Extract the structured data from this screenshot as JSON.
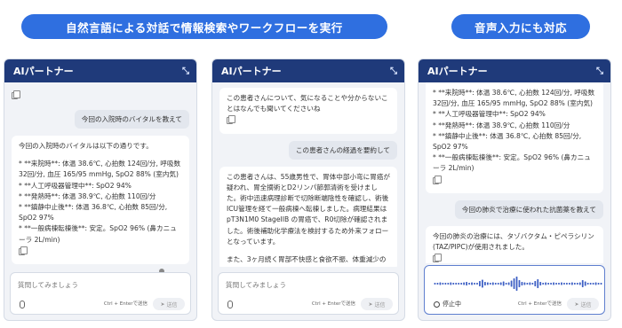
{
  "banners": {
    "left": "自然言語による対話で情報検索やワークフローを実行",
    "right": "音声入力にも対応"
  },
  "panel_title": "AIパートナー",
  "input": {
    "placeholder": "質問してみましょう",
    "hint": "Ctrl + Enterで送信",
    "send_label": "送信"
  },
  "panel1": {
    "user_msg": "今回の入院時のバイタルを教えて",
    "ai_intro": "今回の入院時のバイタルは以下の通りです。",
    "ai_lines": [
      "*  **来院時**: 体温 38.6℃, 心拍数 124回/分, 呼吸数32回/分, 血圧 165/95 mmHg, SpO2 88% (室内気)",
      "*  **人工呼吸器管理中**: SpO2 94%",
      "*  **発熱時**: 体温 38.9℃, 心拍数 110回/分",
      "*  **鎮静中止後**: 体温 36.8℃, 心拍数 85回/分, SpO2 97%",
      "*  **一般病棟転棟後**: 安定。SpO2 96% (鼻カニューラ 2L/min)"
    ]
  },
  "panel2": {
    "ai_greeting": "この患者さんについて、気になることや分からないことはなんでも聞いてくださいね",
    "user_msg": "この患者さんの経過を要約して",
    "ai_summary": "この患者さんは、55歳男性で、胃体中部小弯に胃癌が疑われ、胃全摘術とD2リンパ節郭清術を受けました。術中迅速病理診断で切除断端陰性を確認し、術後ICU管理を経て一般病棟へ転棟しました。病理結果はpT3N1M0 StageIIB の胃癌で、R0切除が確認されました。術後補助化学療法を検討するため外来フォローとなっています。",
    "ai_more": "また、3ヶ月続く胃部不快感と食欲不振、体重減少の"
  },
  "panel3": {
    "ai_lines": [
      "*  **来院時**: 体温 38.6℃, 心拍数 124回/分, 呼吸数 32回/分, 血圧 165/95 mmHg, SpO2 88% (室内気)",
      "*  **人工呼吸器管理中**: SpO2 94%",
      "*  **発熱時**: 体温 38.9℃, 心拍数 110回/分",
      "*  **鎮静中止後**: 体温 36.8℃, 心拍数 85回/分, SpO2 97%",
      "*  **一般病棟転棟後**: 安定。SpO2 96% (鼻カニューラ 2L/min)"
    ],
    "user_msg": "今回の肺炎で治療に使われた抗菌薬を教えて",
    "ai_answer": "今回の肺炎の治療には、タゾバクタム・ピペラシリン(TAZ/PIPC)が使用されました。",
    "stop_label": "停止中"
  },
  "colors": {
    "banner": "#2f6fe0",
    "header": "#1f3a7a",
    "panel_bg": "#f1f3f7",
    "wave": "#3d5fc4"
  }
}
